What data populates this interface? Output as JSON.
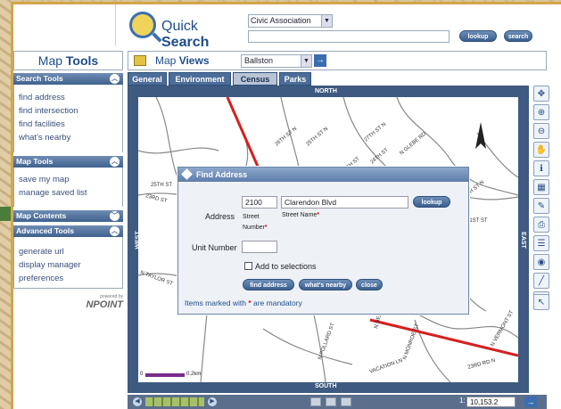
{
  "quick_search": {
    "title_light": "Quick ",
    "title_bold": "Search",
    "type_selected": "Civic Association",
    "query_value": "",
    "lookup_label": "lookup",
    "search_label": "search"
  },
  "map_tools": {
    "title_light": "Map ",
    "title_bold": "Tools",
    "sections": [
      {
        "title": "Search Tools",
        "links": [
          "find address",
          "find intersection",
          "find facilities",
          "what's nearby"
        ]
      },
      {
        "title": "Map Tools",
        "links": [
          "save my map",
          "manage saved list"
        ]
      },
      {
        "title": "Map Contents",
        "links": []
      },
      {
        "title": "Advanced Tools",
        "links": [
          "generate url",
          "display manager",
          "preferences"
        ]
      }
    ],
    "powered_small": "powered by",
    "powered_logo": "NPOINT"
  },
  "map_views": {
    "title_light": "Map ",
    "title_bold": "Views",
    "selected": "Ballston",
    "go": "→"
  },
  "tabs": [
    "General",
    "Environment",
    "Census",
    "Parks"
  ],
  "active_tab": "Census",
  "compass": {
    "north": "NORTH",
    "south": "SOUTH",
    "east": "EAST",
    "west": "WEST"
  },
  "scale_bar": {
    "start": "0",
    "end": "0.2km"
  },
  "street_labels": [
    "26TH ST N",
    "25TH ST N",
    "27TH ST N",
    "N GLEBE RD",
    "17TH ST",
    "24TH ST",
    "27TH ST N",
    "23RD ST",
    "N TAYLOR ST",
    "21ST ST",
    "N POLLARD ST",
    "VACATION LN",
    "N MONROE ST",
    "23RD RD N",
    "N VERMONT ST",
    "N NELSON ST",
    "25TH ST"
  ],
  "bottom_bar": {
    "scale_prefix": "1:",
    "scale_value": "10,153.2",
    "go": "→"
  },
  "find_address": {
    "title": "Find Address",
    "address_label": "Address",
    "street_number_value": "2100",
    "street_name_value": "Clarendon Blvd",
    "lookup_label": "lookup",
    "street_number_caption": "Street Number",
    "street_name_caption": "Street Name",
    "unit_label": "Unit Number",
    "unit_value": "",
    "add_to_selections": "Add to selections",
    "btn_find": "find address",
    "btn_nearby": "what's nearby",
    "btn_close": "close",
    "note_pre": "Items marked with ",
    "note_star": "*",
    "note_post": " are mandatory"
  },
  "colors": {
    "road_red": "#d42020",
    "panel_blue": "#3f628e",
    "frame_gold": "#d3a64c"
  }
}
